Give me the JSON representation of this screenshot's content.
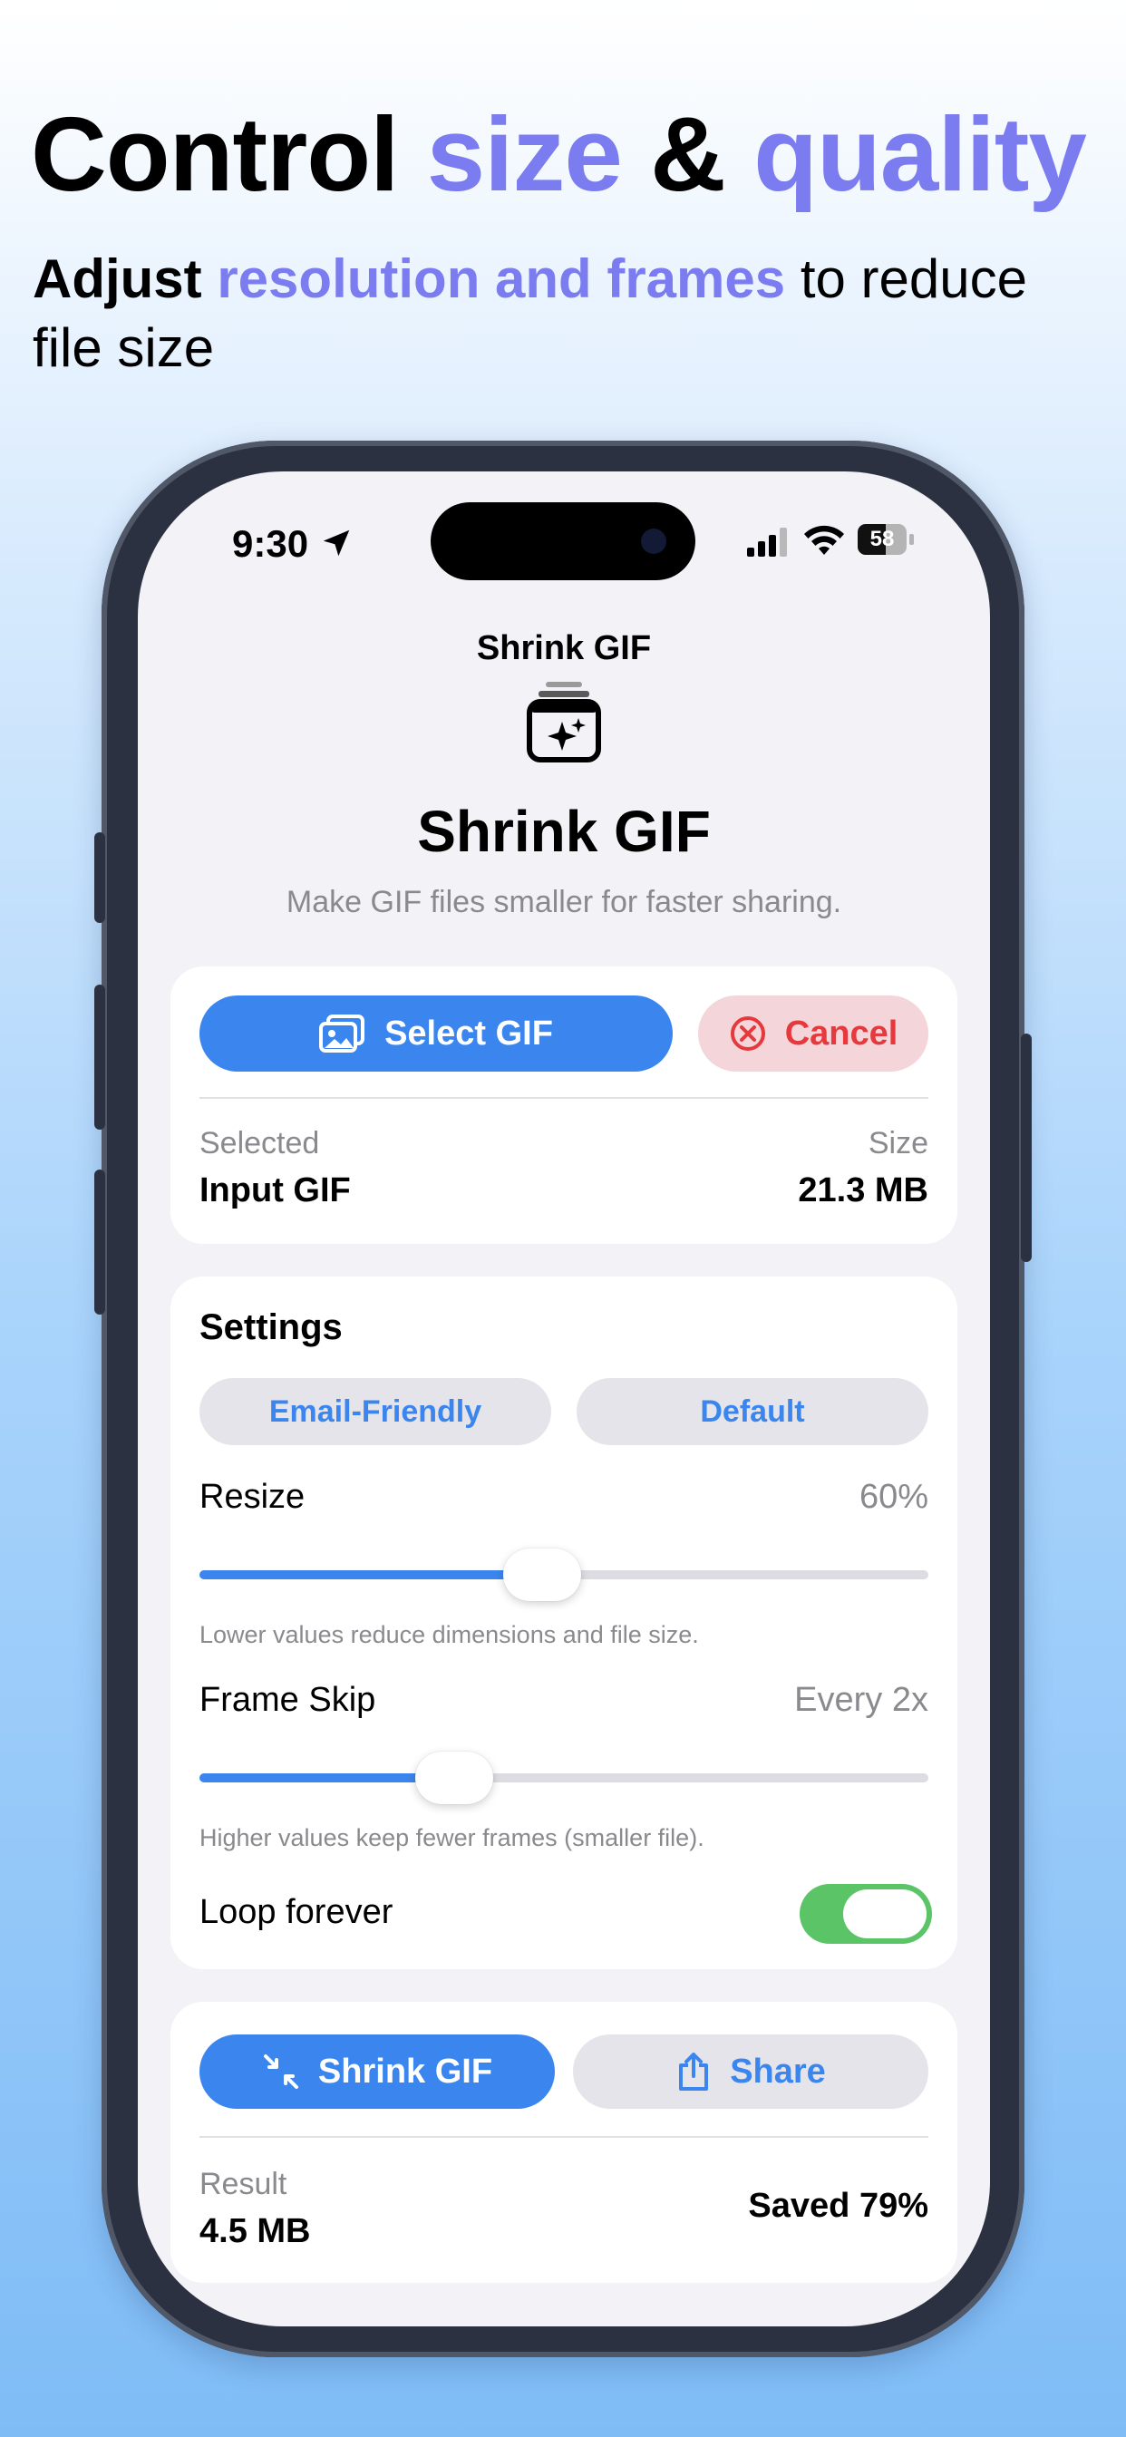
{
  "promo": {
    "headline_part1": "Control",
    "headline_part2": "size",
    "headline_part3": "&",
    "headline_part4": "quality",
    "sub_part1": "Adjust",
    "sub_part2": "resolution and frames",
    "sub_part3": "to reduce file size",
    "accent_color": "#7b7cf0"
  },
  "status_bar": {
    "time": "9:30",
    "battery": "58",
    "battery_level": 0.58,
    "icons": [
      "location-arrow-icon",
      "cellular-signal-icon",
      "wifi-icon",
      "battery-icon"
    ]
  },
  "nav": {
    "title": "Shrink GIF"
  },
  "app": {
    "title": "Shrink GIF",
    "subtitle": "Make GIF files smaller for faster sharing.",
    "icon": "gif-stack-sparkle-icon"
  },
  "select_card": {
    "select_label": "Select GIF",
    "cancel_label": "Cancel",
    "selected_label": "Selected",
    "selected_value": "Input GIF",
    "size_label": "Size",
    "size_value": "21.3 MB"
  },
  "settings": {
    "title": "Settings",
    "presets": [
      "Email-Friendly",
      "Default"
    ],
    "resize": {
      "label": "Resize",
      "value": "60%",
      "level": 0.47,
      "hint": "Lower values reduce dimensions and file size."
    },
    "frame_skip": {
      "label": "Frame Skip",
      "value": "Every 2x",
      "level": 0.35,
      "hint": "Higher values keep fewer frames (smaller file)."
    },
    "loop": {
      "label": "Loop forever",
      "on": true
    }
  },
  "action_card": {
    "shrink_label": "Shrink GIF",
    "share_label": "Share",
    "result_label": "Result",
    "result_value": "4.5 MB",
    "saved_label": "Saved 79%"
  },
  "colors": {
    "primary": "#3a86ee",
    "danger": "#e5393d",
    "toggle_on": "#5bc466"
  }
}
